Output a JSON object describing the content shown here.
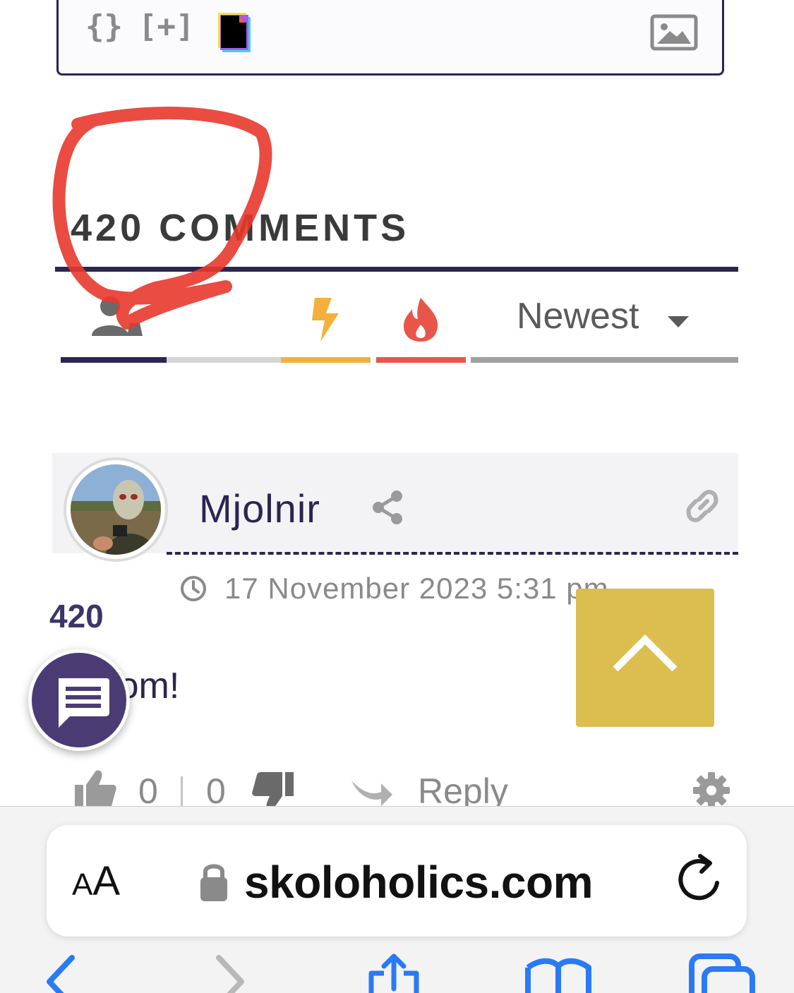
{
  "editor_toolbar": {
    "code_label": "{}",
    "spoiler_label": "[+]",
    "icons": [
      "gif-icon",
      "image-icon"
    ]
  },
  "comments": {
    "title": "420 COMMENTS",
    "sort": {
      "icons": [
        "user-icon",
        "bolt-icon",
        "fire-icon"
      ],
      "selected_label": "Newest",
      "colors": {
        "active": "#2b2550",
        "bolt": "#f3b13b",
        "fire": "#e8564a"
      }
    }
  },
  "comment": {
    "author": "Mjolnir",
    "date": "17 November 2023 5:31 pm",
    "vote_count": "420",
    "text": "Boom!",
    "likes": "0",
    "dislikes": "0",
    "reply_label": "Reply"
  },
  "overlay": {
    "scribble_color": "#e8392c",
    "scroll_top_color": "#dcbd50",
    "chat_fab_color": "#4b3b74"
  },
  "browser": {
    "text_size_label_small": "A",
    "text_size_label_large": "A",
    "url": "skoloholics.com",
    "accent_color": "#2a7af5"
  }
}
